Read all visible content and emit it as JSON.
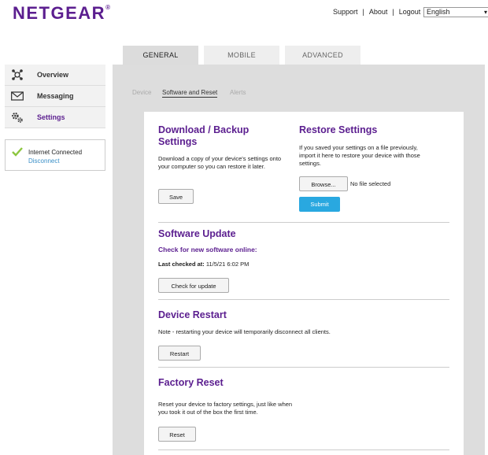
{
  "header": {
    "logo": "NETGEAR",
    "links": [
      "Support",
      "About",
      "Logout"
    ],
    "language": "English"
  },
  "tabs": [
    "GENERAL",
    "MOBILE",
    "ADVANCED"
  ],
  "sidebar": {
    "items": [
      {
        "label": "Overview",
        "icon": "network-icon"
      },
      {
        "label": "Messaging",
        "icon": "envelope-icon"
      },
      {
        "label": "Settings",
        "icon": "gears-icon"
      }
    ],
    "status": {
      "text": "Internet Connected",
      "link": "Disconnect",
      "status_color": "#8cc63f"
    }
  },
  "subtabs": [
    "Device",
    "Software and Reset",
    "Alerts"
  ],
  "sections": {
    "backup": {
      "title": "Download / Backup Settings",
      "desc": "Download a copy of your device's settings onto your computer so you can restore it later.",
      "button": "Save"
    },
    "restore": {
      "title": "Restore Settings",
      "desc": "If you saved your settings on a file previously, import it here to restore your device with those settings.",
      "browse": "Browse...",
      "file_status": "No file selected",
      "submit": "Submit"
    },
    "update": {
      "title": "Software Update",
      "subtitle": "Check for new software online:",
      "last_label": "Last checked at:",
      "last_value": "11/5/21 6:02 PM",
      "button": "Check for update"
    },
    "restart": {
      "title": "Device Restart",
      "desc": "Note - restarting your device will temporarily disconnect all clients.",
      "button": "Restart"
    },
    "reset": {
      "title": "Factory Reset",
      "desc": "Reset your device to factory settings, just like when you took it out of the box the first time.",
      "button": "Reset"
    }
  },
  "colors": {
    "brand": "#5b1e8f",
    "accent": "#29a8e0"
  }
}
